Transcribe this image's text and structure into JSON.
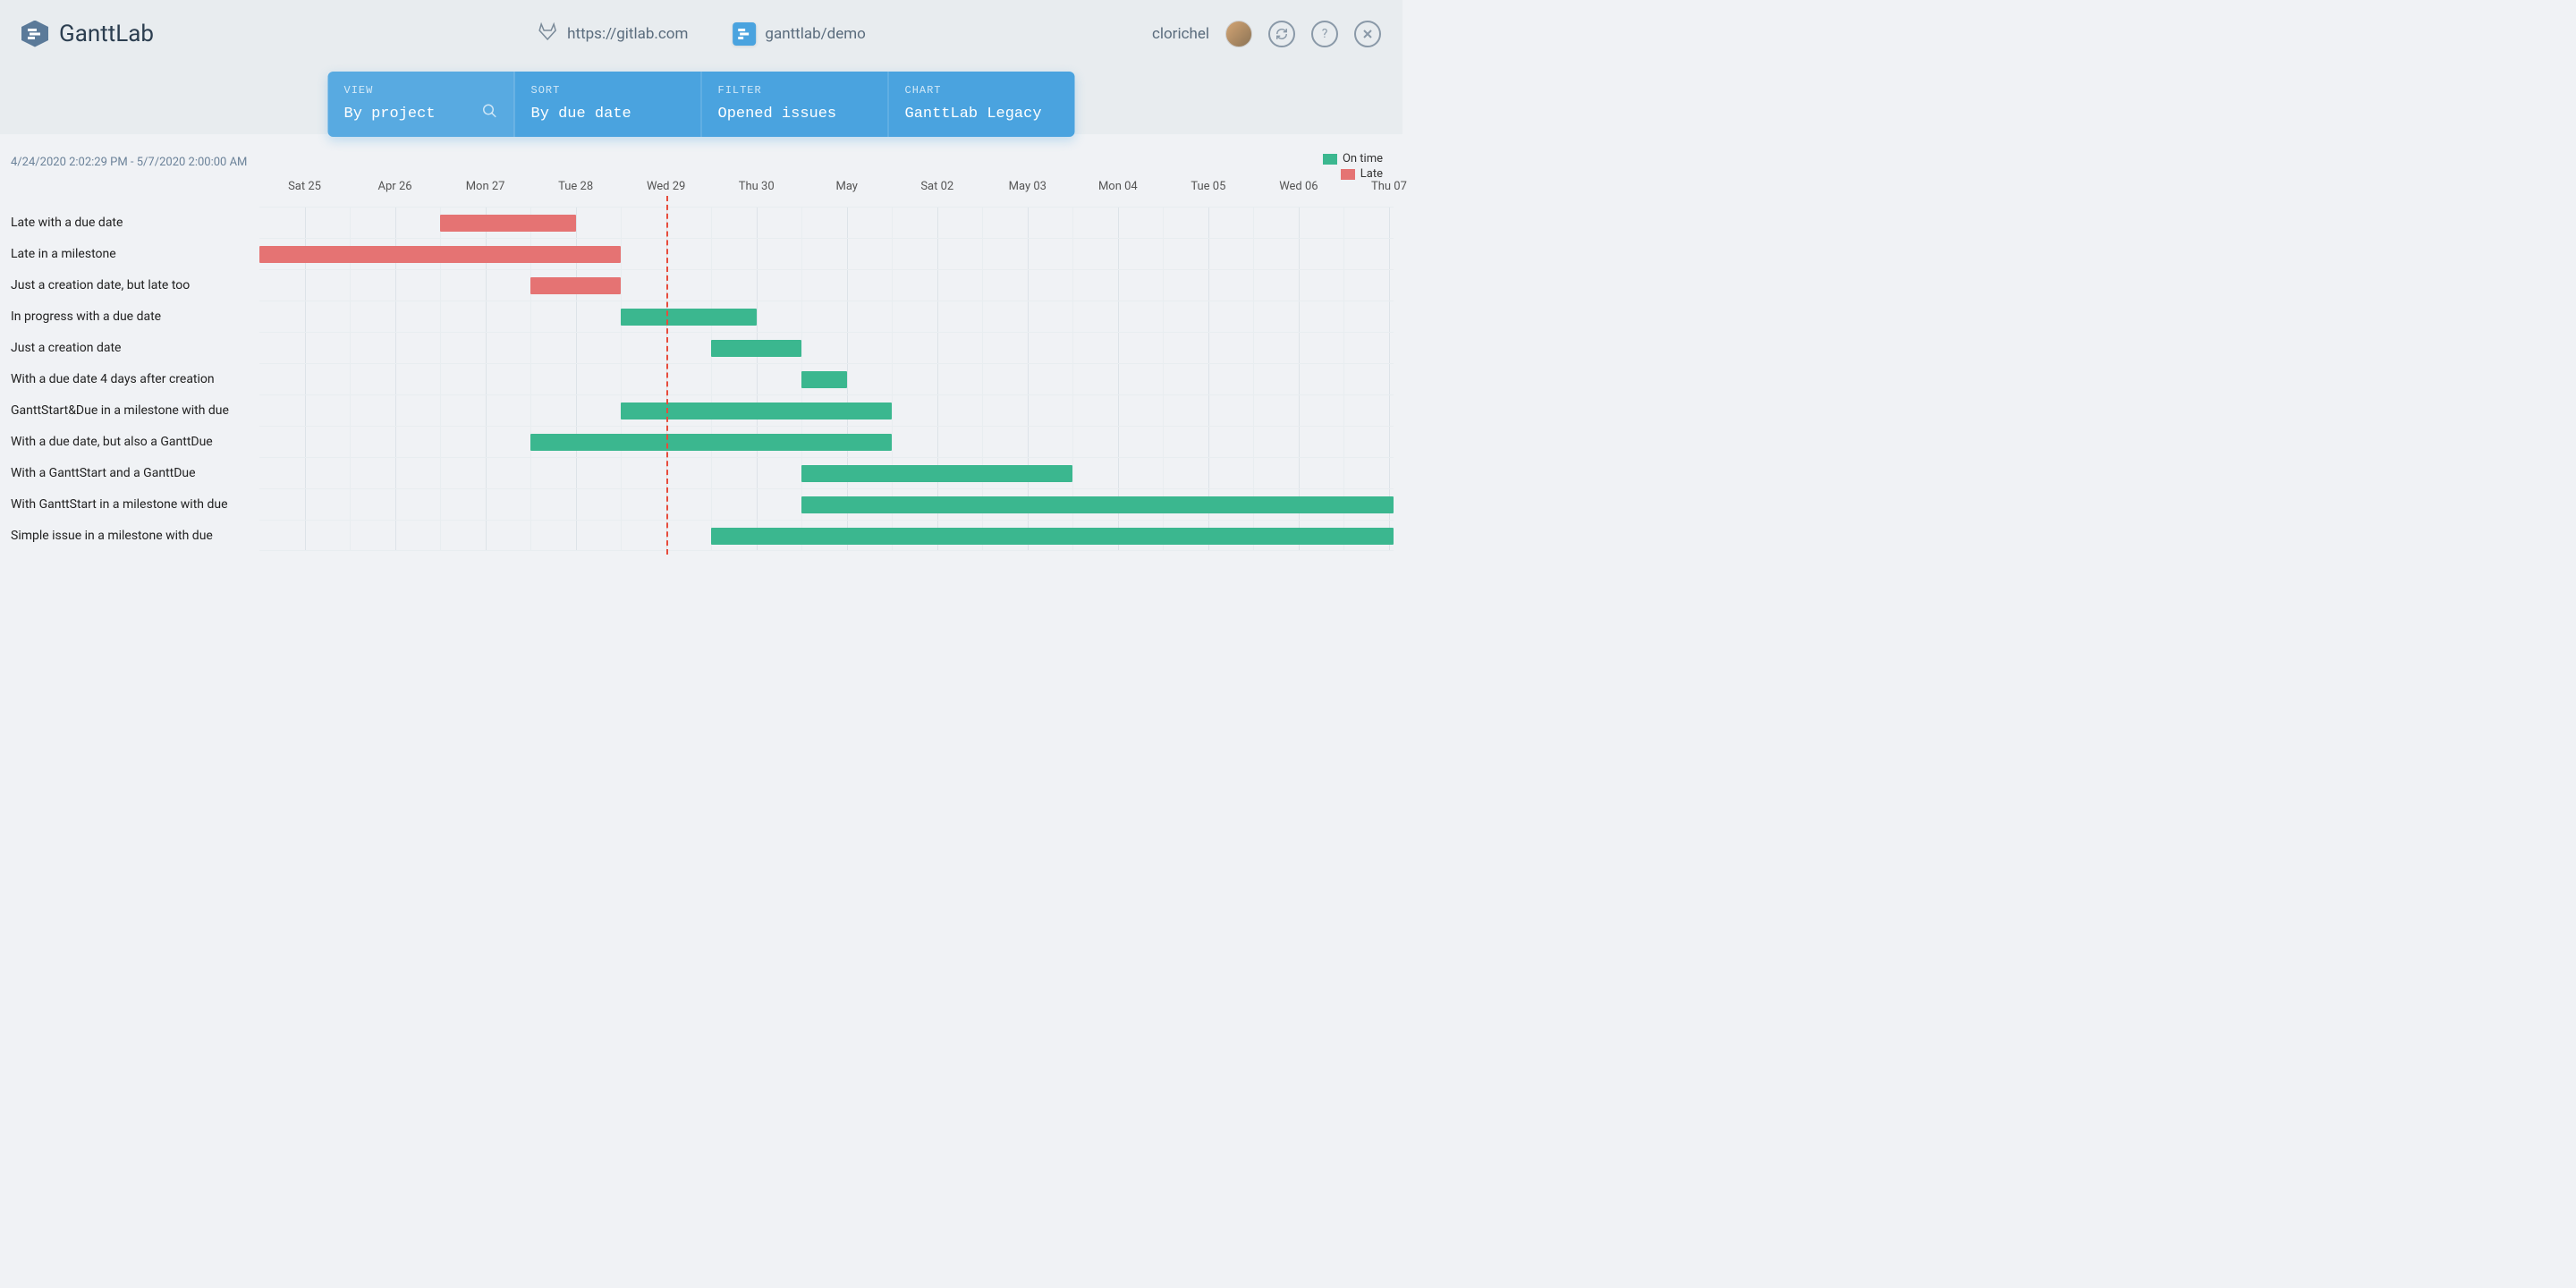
{
  "app": {
    "title": "GanttLab"
  },
  "header": {
    "gitlab_url": "https://gitlab.com",
    "project_path": "ganttlab/demo",
    "username": "clorichel"
  },
  "controls": {
    "view": {
      "label": "VIEW",
      "value": "By project"
    },
    "sort": {
      "label": "SORT",
      "value": "By due date"
    },
    "filter": {
      "label": "FILTER",
      "value": "Opened issues"
    },
    "chart": {
      "label": "CHART",
      "value": "GanttLab Legacy"
    }
  },
  "legend": {
    "on_time": {
      "label": "On time",
      "color": "#3bb78f"
    },
    "late": {
      "label": "Late",
      "color": "#e57373"
    }
  },
  "timestamp_range": "4/24/2020 2:02:29 PM - 5/7/2020 2:00:00 AM",
  "chart_data": {
    "type": "gantt",
    "today_index": 4.5,
    "dates": [
      {
        "label": "Sat 25",
        "pos": 0
      },
      {
        "label": "Apr 26",
        "pos": 1
      },
      {
        "label": "Mon 27",
        "pos": 2
      },
      {
        "label": "Tue 28",
        "pos": 3
      },
      {
        "label": "Wed 29",
        "pos": 4
      },
      {
        "label": "Thu 30",
        "pos": 5
      },
      {
        "label": "May",
        "pos": 6
      },
      {
        "label": "Sat 02",
        "pos": 7
      },
      {
        "label": "May 03",
        "pos": 8
      },
      {
        "label": "Mon 04",
        "pos": 9
      },
      {
        "label": "Tue 05",
        "pos": 10
      },
      {
        "label": "Wed 06",
        "pos": 11
      },
      {
        "label": "Thu 07",
        "pos": 12
      }
    ],
    "tasks": [
      {
        "name": "Late with a due date",
        "start": 2.0,
        "end": 3.5,
        "status": "late"
      },
      {
        "name": "Late in a milestone",
        "start": 0.0,
        "end": 4.0,
        "status": "late"
      },
      {
        "name": "Just a creation date, but late too",
        "start": 3.0,
        "end": 4.0,
        "status": "late"
      },
      {
        "name": "In progress with a due date",
        "start": 4.0,
        "end": 5.5,
        "status": "ontime"
      },
      {
        "name": "Just a creation date",
        "start": 5.0,
        "end": 6.0,
        "status": "ontime"
      },
      {
        "name": "With a due date 4 days after creation",
        "start": 6.0,
        "end": 6.5,
        "status": "ontime"
      },
      {
        "name": "GanttStart&Due in a milestone with due",
        "start": 4.0,
        "end": 7.0,
        "status": "ontime"
      },
      {
        "name": "With a due date, but also a GanttDue",
        "start": 3.0,
        "end": 7.0,
        "status": "ontime"
      },
      {
        "name": "With a GanttStart and a GanttDue",
        "start": 6.0,
        "end": 9.0,
        "status": "ontime"
      },
      {
        "name": "With GanttStart in a milestone with due",
        "start": 6.0,
        "end": 12.55,
        "status": "ontime"
      },
      {
        "name": "Simple issue in a milestone with due",
        "start": 5.0,
        "end": 12.55,
        "status": "ontime"
      }
    ]
  }
}
